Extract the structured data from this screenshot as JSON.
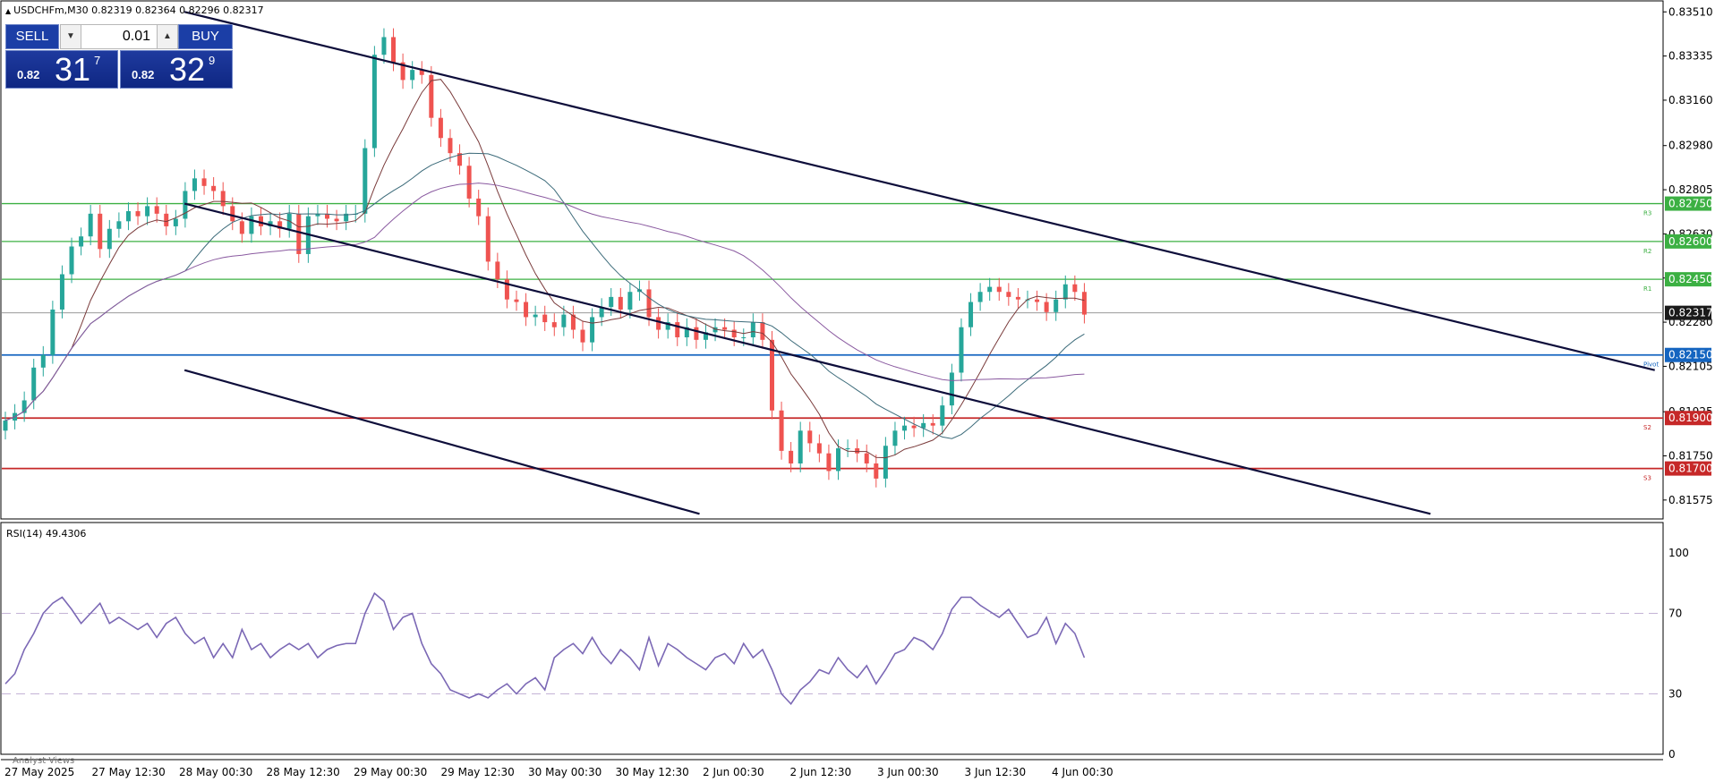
{
  "header": {
    "symbol_line": "USDCHFm,M30  0.82319 0.82364 0.82296 0.82317"
  },
  "trade_panel": {
    "sell_label": "SELL",
    "buy_label": "BUY",
    "lot_value": "0.01",
    "sell_price_prefix": "0.82",
    "sell_price_big": "31",
    "sell_price_sup": "7",
    "buy_price_prefix": "0.82",
    "buy_price_big": "32",
    "buy_price_sup": "9"
  },
  "rsi_header": "RSI(14) 49.4306",
  "analyst_views": "Analyst Views",
  "colors": {
    "up_candle": "#26a69a",
    "down_candle": "#ef5350",
    "resistance": "#3cb043",
    "pivot": "#1565c0",
    "support": "#c62828",
    "channel": "#0d0d3a",
    "rsi_line": "#7b68b5",
    "current_price": "#555555"
  },
  "chart_data": [
    {
      "type": "candlestick",
      "symbol": "USDCHFm",
      "timeframe": "M30",
      "ylim": [
        0.815,
        0.8355
      ],
      "y_ticks": [
        "0.83510",
        "0.83335",
        "0.83160",
        "0.82980",
        "0.82805",
        "0.82630",
        "0.82455",
        "0.82280",
        "0.82105",
        "0.81925",
        "0.81750",
        "0.81575"
      ],
      "x_tick_labels": [
        "27 May 2025",
        "27 May 12:30",
        "28 May 00:30",
        "28 May 12:30",
        "29 May 00:30",
        "29 May 12:30",
        "30 May 00:30",
        "30 May 12:30",
        "2 Jun 00:30",
        "2 Jun 12:30",
        "3 Jun 00:30",
        "3 Jun 12:30",
        "4 Jun 00:30"
      ],
      "current_price": {
        "value": 0.82317,
        "label": "0.82317"
      },
      "levels": [
        {
          "name": "R3",
          "value": 0.8275,
          "label": "0.82750",
          "kind": "resistance"
        },
        {
          "name": "R2",
          "value": 0.826,
          "label": "0.82600",
          "kind": "resistance"
        },
        {
          "name": "R1",
          "value": 0.8245,
          "label": "0.82450",
          "kind": "resistance"
        },
        {
          "name": "Pivot",
          "value": 0.8215,
          "label": "0.82150",
          "kind": "pivot"
        },
        {
          "name": "S2",
          "value": 0.819,
          "label": "0.81900",
          "kind": "support"
        },
        {
          "name": "S3",
          "value": 0.817,
          "label": "0.81700",
          "kind": "support"
        }
      ],
      "channel_lines": [
        {
          "name": "upper",
          "from": [
            0.11,
            0.8351
          ],
          "to": [
            0.995,
            0.8209
          ]
        },
        {
          "name": "middle",
          "from": [
            0.11,
            0.8275
          ],
          "to": [
            0.86,
            0.8152
          ]
        },
        {
          "name": "lower",
          "from": [
            0.11,
            0.8209
          ],
          "to": [
            0.42,
            0.8152
          ]
        }
      ],
      "close_series": [
        0.8189,
        0.8192,
        0.8197,
        0.821,
        0.8215,
        0.8233,
        0.8247,
        0.8258,
        0.8262,
        0.8271,
        0.8257,
        0.8265,
        0.8268,
        0.8272,
        0.827,
        0.8274,
        0.8271,
        0.8266,
        0.8269,
        0.828,
        0.8285,
        0.8282,
        0.828,
        0.8274,
        0.8268,
        0.8263,
        0.827,
        0.8266,
        0.8268,
        0.8265,
        0.8271,
        0.8255,
        0.827,
        0.8271,
        0.8269,
        0.8268,
        0.8271,
        0.8271,
        0.8297,
        0.8334,
        0.8341,
        0.8331,
        0.8324,
        0.8328,
        0.8326,
        0.8309,
        0.8301,
        0.8295,
        0.829,
        0.8277,
        0.827,
        0.8252,
        0.8245,
        0.8237,
        0.8236,
        0.823,
        0.8231,
        0.8228,
        0.8226,
        0.8231,
        0.8225,
        0.822,
        0.823,
        0.8234,
        0.8238,
        0.8233,
        0.824,
        0.8241,
        0.823,
        0.8225,
        0.8228,
        0.8222,
        0.8226,
        0.8221,
        0.8224,
        0.8226,
        0.8225,
        0.8222,
        0.8222,
        0.8228,
        0.8221,
        0.8193,
        0.8177,
        0.8172,
        0.8185,
        0.818,
        0.8176,
        0.8169,
        0.8178,
        0.8178,
        0.8176,
        0.8172,
        0.8166,
        0.8179,
        0.8185,
        0.8187,
        0.8186,
        0.8188,
        0.8187,
        0.8195,
        0.8208,
        0.8226,
        0.8236,
        0.824,
        0.8242,
        0.824,
        0.8238,
        0.8237,
        0.8237,
        0.8236,
        0.8232,
        0.8237,
        0.8243,
        0.824,
        0.8231
      ]
    },
    {
      "type": "line",
      "indicator": "RSI(14)",
      "value_label": "49.4306",
      "ylim": [
        0,
        100
      ],
      "y_ticks": [
        "100",
        "70",
        "30",
        "0"
      ],
      "levels": [
        70,
        30
      ],
      "values": [
        35,
        40,
        52,
        60,
        70,
        75,
        78,
        72,
        65,
        70,
        75,
        65,
        68,
        65,
        62,
        65,
        58,
        65,
        68,
        60,
        55,
        58,
        48,
        55,
        48,
        62,
        52,
        55,
        48,
        52,
        55,
        52,
        55,
        48,
        52,
        54,
        55,
        55,
        70,
        80,
        76,
        62,
        68,
        70,
        55,
        45,
        40,
        32,
        30,
        28,
        30,
        28,
        32,
        35,
        30,
        35,
        38,
        32,
        48,
        52,
        55,
        50,
        58,
        50,
        45,
        52,
        48,
        42,
        58,
        44,
        55,
        52,
        48,
        45,
        42,
        48,
        50,
        45,
        55,
        48,
        52,
        42,
        30,
        25,
        32,
        36,
        42,
        40,
        48,
        42,
        38,
        44,
        35,
        42,
        50,
        52,
        58,
        56,
        52,
        60,
        72,
        78,
        78,
        74,
        71,
        68,
        72,
        65,
        58,
        60,
        68,
        55,
        65,
        60,
        48
      ]
    }
  ]
}
